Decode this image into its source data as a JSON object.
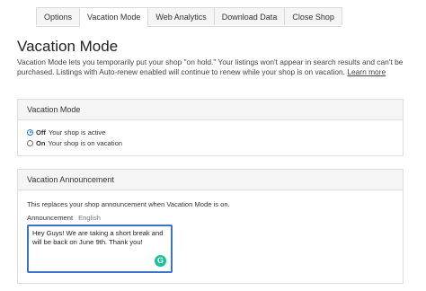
{
  "tabs": [
    {
      "label": "Options",
      "active": false
    },
    {
      "label": "Vacation Mode",
      "active": true
    },
    {
      "label": "Web Analytics",
      "active": false
    },
    {
      "label": "Download Data",
      "active": false
    },
    {
      "label": "Close Shop",
      "active": false
    }
  ],
  "page": {
    "title": "Vacation Mode",
    "description": "Vacation Mode lets you temporarily put your shop \"on hold.\" Your listings won't appear in search results and can't be purchased. Listings with Auto-renew enabled will continue to renew while your shop is on vacation.",
    "learn_more": "Learn more"
  },
  "vacation_panel": {
    "header": "Vacation Mode",
    "options": [
      {
        "label": "Off",
        "description": "Your shop is active",
        "checked": true
      },
      {
        "label": "On",
        "description": "Your shop is on vacation",
        "checked": false
      }
    ]
  },
  "announcement_panel": {
    "header": "Vacation Announcement",
    "note": "This replaces your shop announcement when Vacation Mode is on.",
    "field_label": "Announcement",
    "field_language": "English",
    "value": "Hey Guys! We are taking a short break and will be back on June 9th. Thank you!",
    "grammarly_icon": "G"
  },
  "colors": {
    "accent": "#3b73c8",
    "grammarly": "#15c39a"
  }
}
